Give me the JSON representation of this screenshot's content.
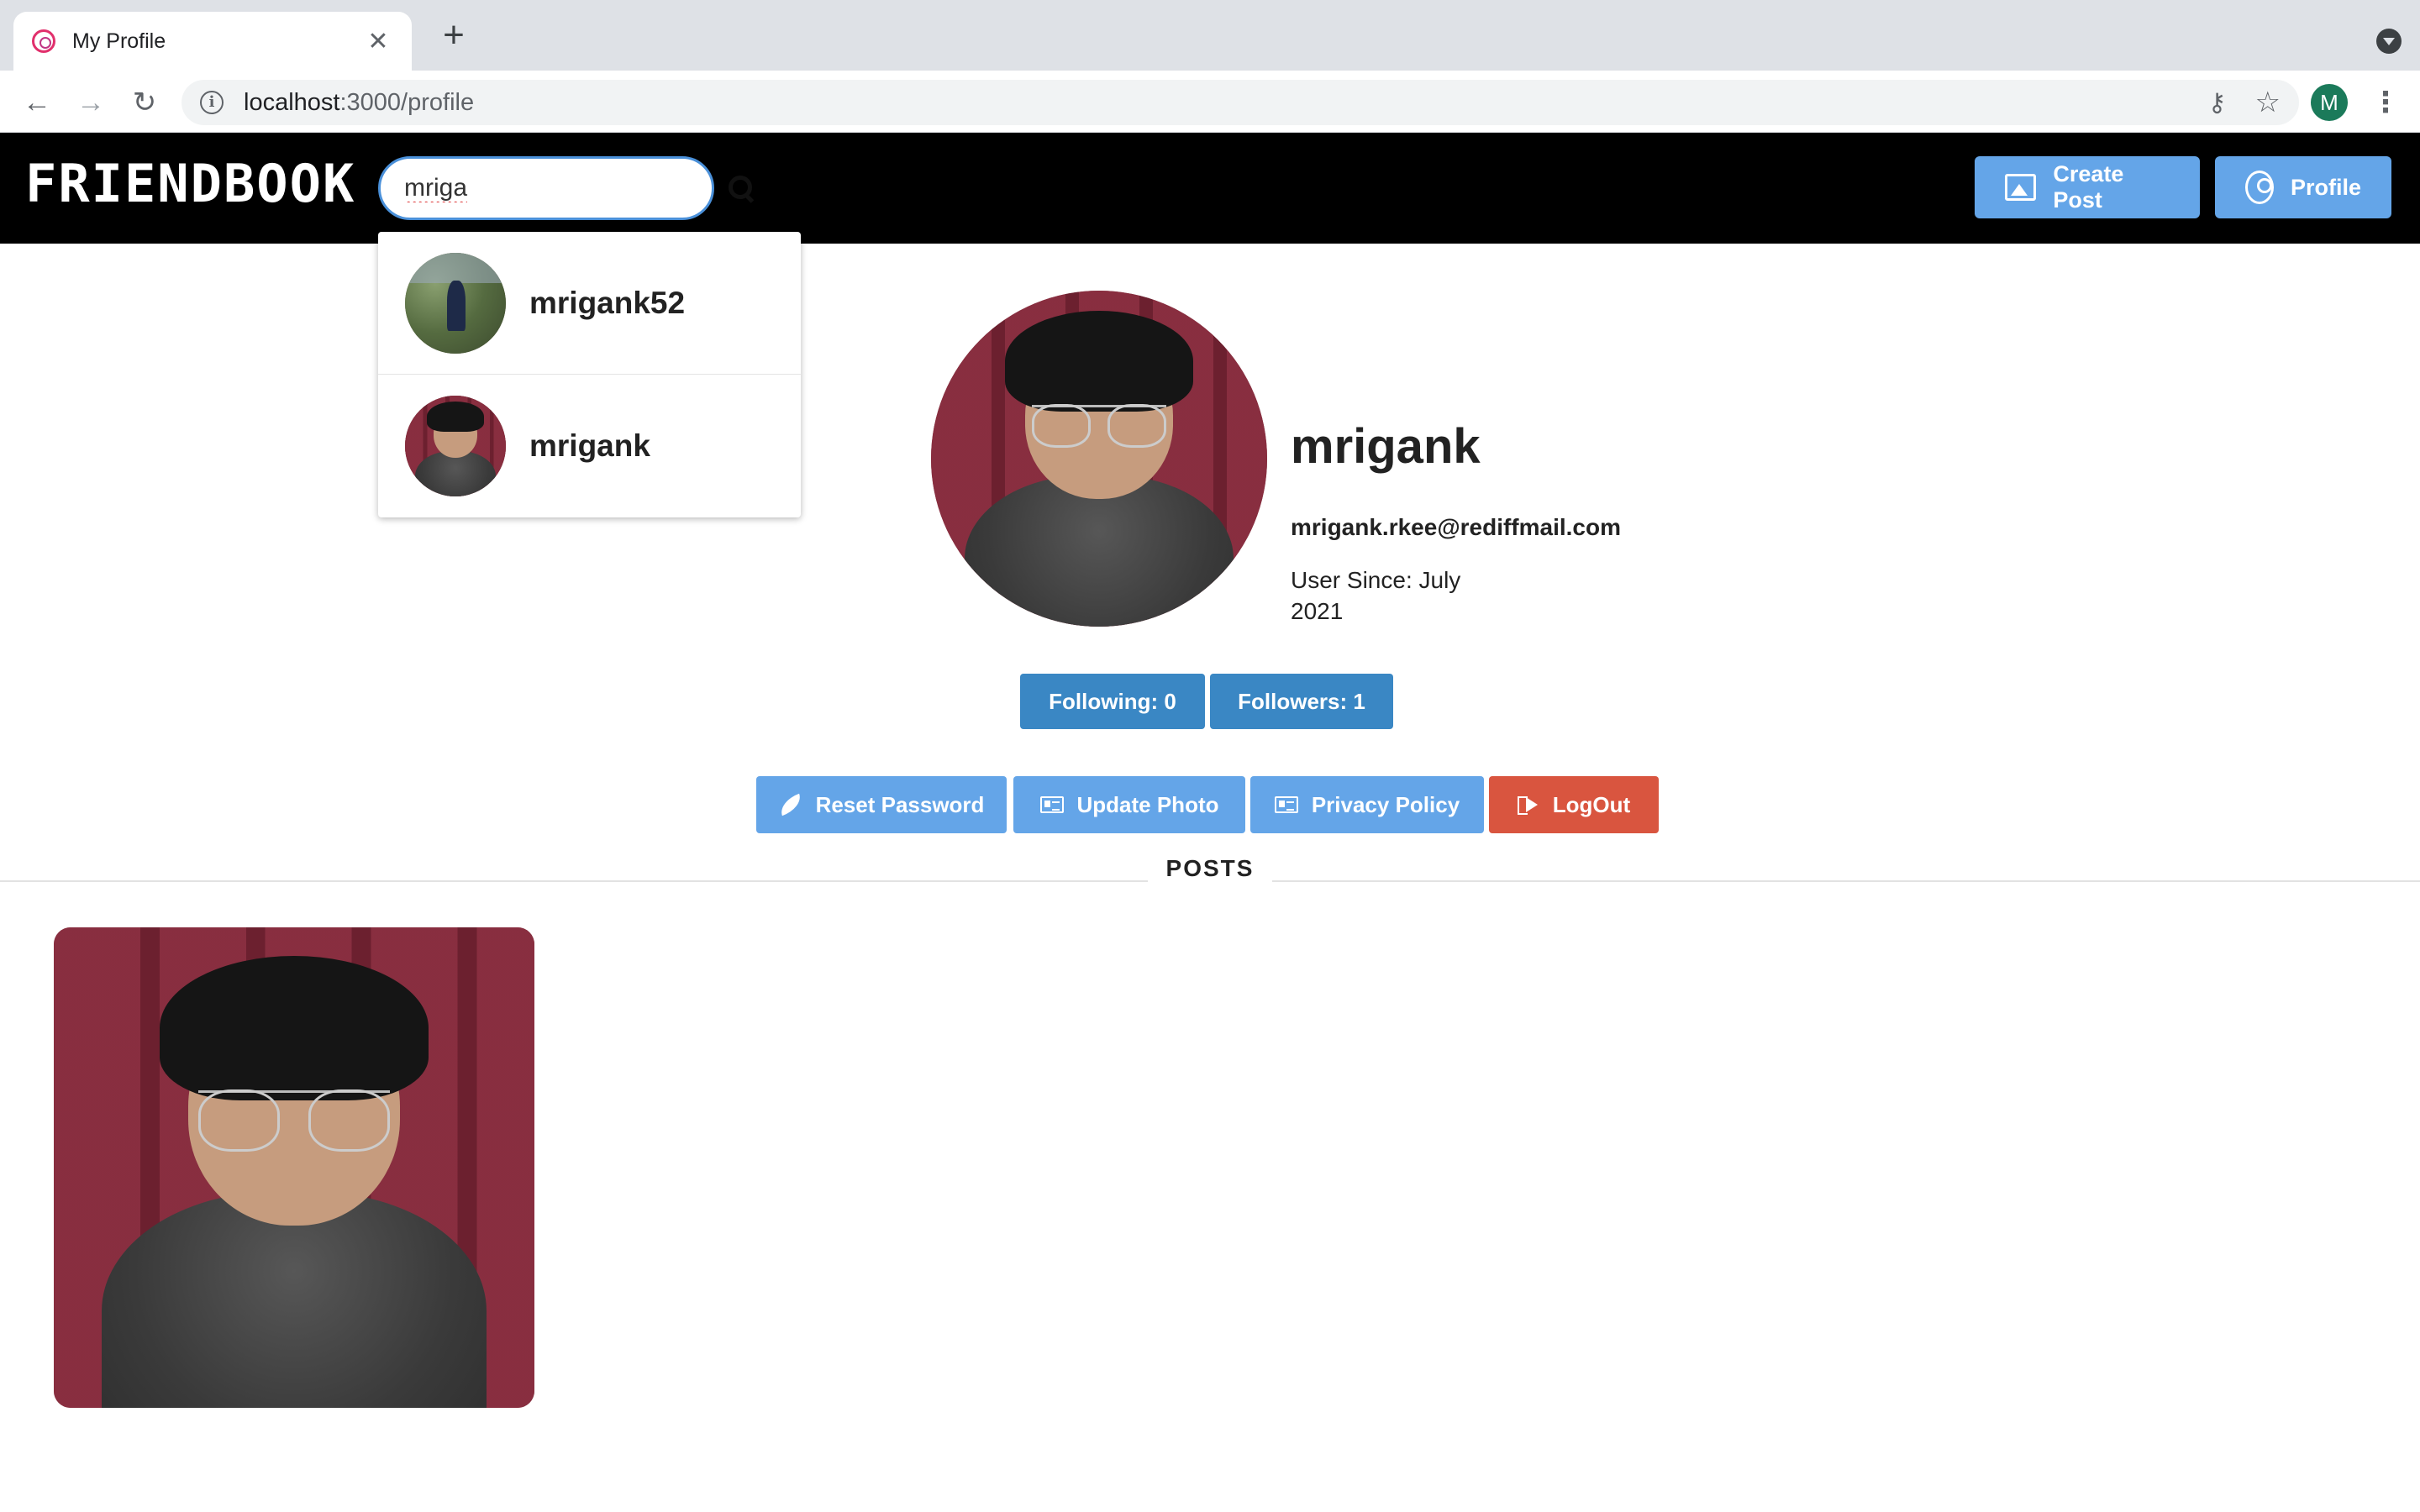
{
  "browser": {
    "tab_title": "My Profile",
    "tab_close": "✕",
    "new_tab": "+",
    "url_host": "localhost",
    "url_path": ":3000/profile",
    "account_initial": "M",
    "back": "←",
    "forward": "→",
    "reload": "↻",
    "menu": "⋮",
    "key": "⚷",
    "star": "☆"
  },
  "navbar": {
    "logo": "FRIENDBOOK",
    "search_value": "mriga",
    "create_post_label": "Create Post",
    "profile_label": "Profile"
  },
  "search_results": [
    {
      "username": "mrigank52"
    },
    {
      "username": "mrigank"
    }
  ],
  "profile": {
    "name": "mrigank",
    "email": "mrigank.rkee@rediffmail.com",
    "user_since": "User Since: July 2021",
    "following_label": "Following: 0",
    "followers_label": "Followers: 1"
  },
  "actions": {
    "reset_password": "Reset Password",
    "update_photo": "Update Photo",
    "privacy_policy": "Privacy Policy",
    "logout": "LogOut"
  },
  "posts": {
    "section_label": "POSTS",
    "count_shown": 1
  },
  "colors": {
    "primary_button": "#64a5e8",
    "stat_button": "#3a87c4",
    "logout_button": "#d9553f",
    "navbar_bg": "#000000"
  }
}
